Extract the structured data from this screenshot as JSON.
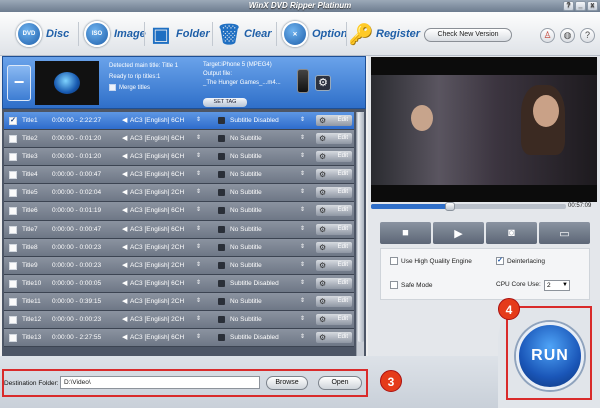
{
  "window": {
    "title": "WinX DVD Ripper Platinum",
    "btn_help": "?",
    "btn_min": "_",
    "btn_close": "x"
  },
  "toolbar": {
    "disc": "Disc",
    "image": "Image",
    "folder": "Folder",
    "clear": "Clear",
    "option": "Option",
    "register": "Register",
    "check_version": "Check New Version",
    "disc_icon": "DVD",
    "image_icon": "ISO"
  },
  "fileinfo": {
    "main_title": "Detected main title: Title 1",
    "ready": "Ready to rip titles:1",
    "merge": "Merge titles",
    "target": "Target:iPhone 5 (MPEG4)",
    "output_label": "Output file:",
    "output_file": "_The Hunger Games_...m4...",
    "set_tag": "SET TAG"
  },
  "titles": [
    {
      "name": "Title1",
      "time": "0:00:00 - 2:22:27",
      "audio": "AC3 [English] 6CH",
      "subtitle": "Subtitle Disabled",
      "checked": true
    },
    {
      "name": "Title2",
      "time": "0:00:00 - 0:01:20",
      "audio": "AC3 [English] 6CH",
      "subtitle": "No Subtitle",
      "checked": false
    },
    {
      "name": "Title3",
      "time": "0:00:00 - 0:01:20",
      "audio": "AC3 [English] 6CH",
      "subtitle": "No Subtitle",
      "checked": false
    },
    {
      "name": "Title4",
      "time": "0:00:00 - 0:00:47",
      "audio": "AC3 [English] 6CH",
      "subtitle": "No Subtitle",
      "checked": false
    },
    {
      "name": "Title5",
      "time": "0:00:00 - 0:02:04",
      "audio": "AC3 [English] 2CH",
      "subtitle": "No Subtitle",
      "checked": false
    },
    {
      "name": "Title6",
      "time": "0:00:00 - 0:01:19",
      "audio": "AC3 [English] 6CH",
      "subtitle": "No Subtitle",
      "checked": false
    },
    {
      "name": "Title7",
      "time": "0:00:00 - 0:00:47",
      "audio": "AC3 [English] 6CH",
      "subtitle": "No Subtitle",
      "checked": false
    },
    {
      "name": "Title8",
      "time": "0:00:00 - 0:00:23",
      "audio": "AC3 [English] 2CH",
      "subtitle": "No Subtitle",
      "checked": false
    },
    {
      "name": "Title9",
      "time": "0:00:00 - 0:00:23",
      "audio": "AC3 [English] 2CH",
      "subtitle": "No Subtitle",
      "checked": false
    },
    {
      "name": "Title10",
      "time": "0:00:00 - 0:00:05",
      "audio": "AC3 [English] 6CH",
      "subtitle": "Subtitle Disabled",
      "checked": false
    },
    {
      "name": "Title11",
      "time": "0:00:00 - 0:39:15",
      "audio": "AC3 [English] 2CH",
      "subtitle": "No Subtitle",
      "checked": false
    },
    {
      "name": "Title12",
      "time": "0:00:00 - 0:00:23",
      "audio": "AC3 [English] 2CH",
      "subtitle": "No Subtitle",
      "checked": false
    },
    {
      "name": "Title13",
      "time": "0:00:00 - 2:27:55",
      "audio": "AC3 [English] 6CH",
      "subtitle": "Subtitle Disabled",
      "checked": false
    }
  ],
  "edit_label": "Edit",
  "destination": {
    "label": "Destination Folder:",
    "value": "D:\\Video\\",
    "browse": "Browse",
    "open": "Open"
  },
  "player": {
    "time": "00:57:09",
    "progress": 0.4
  },
  "options": {
    "high_quality": "Use High Quality Engine",
    "high_quality_checked": false,
    "deinterlacing": "Deinterlacing",
    "deinterlacing_checked": true,
    "safe_mode": "Safe Mode",
    "safe_mode_checked": false,
    "cpu_label": "CPU Core Use:",
    "cpu_value": "2"
  },
  "run": "RUN",
  "badges": {
    "three": "3",
    "four": "4"
  }
}
